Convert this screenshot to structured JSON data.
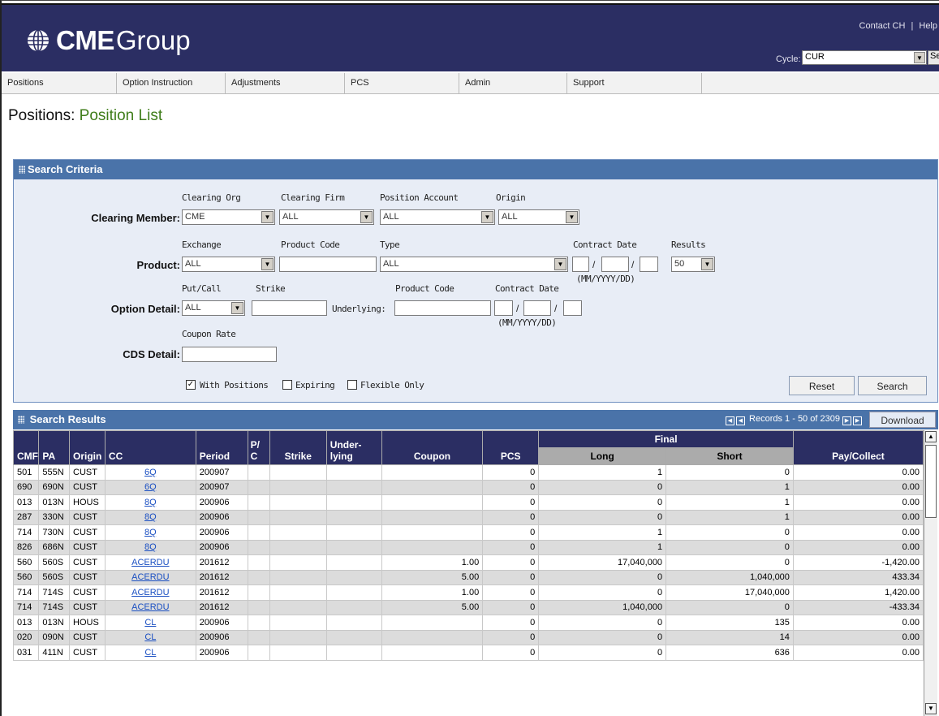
{
  "header": {
    "logo_cme": "CME",
    "logo_group": "Group",
    "links": [
      "Contact CH",
      "Help"
    ],
    "link_sep": "|",
    "cycle_label": "Cycle:",
    "cycle_value": "CUR",
    "go_label": "Se"
  },
  "nav": {
    "items": [
      "Positions",
      "Option Instruction",
      "Adjustments",
      "PCS",
      "Admin",
      "Support",
      ""
    ]
  },
  "page": {
    "title_main": "Positions:",
    "title_sub": "Position List"
  },
  "criteria": {
    "title": "Search Criteria",
    "clearing_member": {
      "label": "Clearing Member:",
      "col_labels": [
        "Clearing Org",
        "Clearing Firm",
        "Position Account",
        "Origin"
      ],
      "values": [
        "CME",
        "ALL",
        "ALL",
        "ALL"
      ]
    },
    "product": {
      "label": "Product:",
      "col_labels": [
        "Exchange",
        "Product Code",
        "Type",
        "Contract Date",
        "Results"
      ],
      "exchange": "ALL",
      "product_code": "",
      "type": "ALL",
      "date_format": "(MM/YYYY/DD)",
      "results": "50"
    },
    "option_detail": {
      "label": "Option Detail:",
      "col_labels": [
        "Put/Call",
        "Strike",
        "Product Code",
        "Contract Date"
      ],
      "put_call": "ALL",
      "strike": "",
      "underlying_label": "Underlying:",
      "underlying": "",
      "date_format": "(MM/YYYY/DD)"
    },
    "cds_detail": {
      "label": "CDS Detail:",
      "col_label": "Coupon Rate",
      "coupon": ""
    },
    "checkboxes": [
      {
        "label": "With Positions",
        "checked": true
      },
      {
        "label": "Expiring",
        "checked": false
      },
      {
        "label": "Flexible Only",
        "checked": false
      }
    ],
    "reset_label": "Reset",
    "search_label": "Search"
  },
  "results": {
    "title": "Search Results",
    "records_text": "Records 1 - 50 of 2309",
    "download_label": "Download",
    "header": {
      "cmf": "CMF",
      "pa": "PA",
      "origin": "Origin",
      "cc": "CC",
      "period": "Period",
      "pc_top": "P/",
      "pc_bottom": "C",
      "strike": "Strike",
      "under_top": "Under-",
      "under_bottom": "lying",
      "coupon": "Coupon",
      "pcs": "PCS",
      "final": "Final",
      "long": "Long",
      "short": "Short",
      "pay": "Pay/Collect"
    },
    "rows": [
      {
        "cmf": "501",
        "pa": "555N",
        "origin": "CUST",
        "cc": "6Q",
        "period": "200907",
        "pc": "",
        "strike": "",
        "under": "",
        "coupon": "",
        "pcs": "0",
        "long": "1",
        "short": "0",
        "pay": "0.00"
      },
      {
        "cmf": "690",
        "pa": "690N",
        "origin": "CUST",
        "cc": "6Q",
        "period": "200907",
        "pc": "",
        "strike": "",
        "under": "",
        "coupon": "",
        "pcs": "0",
        "long": "0",
        "short": "1",
        "pay": "0.00"
      },
      {
        "cmf": "013",
        "pa": "013N",
        "origin": "HOUS",
        "cc": "8Q",
        "period": "200906",
        "pc": "",
        "strike": "",
        "under": "",
        "coupon": "",
        "pcs": "0",
        "long": "0",
        "short": "1",
        "pay": "0.00"
      },
      {
        "cmf": "287",
        "pa": "330N",
        "origin": "CUST",
        "cc": "8Q",
        "period": "200906",
        "pc": "",
        "strike": "",
        "under": "",
        "coupon": "",
        "pcs": "0",
        "long": "0",
        "short": "1",
        "pay": "0.00"
      },
      {
        "cmf": "714",
        "pa": "730N",
        "origin": "CUST",
        "cc": "8Q",
        "period": "200906",
        "pc": "",
        "strike": "",
        "under": "",
        "coupon": "",
        "pcs": "0",
        "long": "1",
        "short": "0",
        "pay": "0.00"
      },
      {
        "cmf": "826",
        "pa": "686N",
        "origin": "CUST",
        "cc": "8Q",
        "period": "200906",
        "pc": "",
        "strike": "",
        "under": "",
        "coupon": "",
        "pcs": "0",
        "long": "1",
        "short": "0",
        "pay": "0.00"
      },
      {
        "cmf": "560",
        "pa": "560S",
        "origin": "CUST",
        "cc": "ACERDU",
        "period": "201612",
        "pc": "",
        "strike": "",
        "under": "",
        "coupon": "1.00",
        "pcs": "0",
        "long": "17,040,000",
        "short": "0",
        "pay": "-1,420.00"
      },
      {
        "cmf": "560",
        "pa": "560S",
        "origin": "CUST",
        "cc": "ACERDU",
        "period": "201612",
        "pc": "",
        "strike": "",
        "under": "",
        "coupon": "5.00",
        "pcs": "0",
        "long": "0",
        "short": "1,040,000",
        "pay": "433.34"
      },
      {
        "cmf": "714",
        "pa": "714S",
        "origin": "CUST",
        "cc": "ACERDU",
        "period": "201612",
        "pc": "",
        "strike": "",
        "under": "",
        "coupon": "1.00",
        "pcs": "0",
        "long": "0",
        "short": "17,040,000",
        "pay": "1,420.00"
      },
      {
        "cmf": "714",
        "pa": "714S",
        "origin": "CUST",
        "cc": "ACERDU",
        "period": "201612",
        "pc": "",
        "strike": "",
        "under": "",
        "coupon": "5.00",
        "pcs": "0",
        "long": "1,040,000",
        "short": "0",
        "pay": "-433.34"
      },
      {
        "cmf": "013",
        "pa": "013N",
        "origin": "HOUS",
        "cc": "CL",
        "period": "200906",
        "pc": "",
        "strike": "",
        "under": "",
        "coupon": "",
        "pcs": "0",
        "long": "0",
        "short": "135",
        "pay": "0.00"
      },
      {
        "cmf": "020",
        "pa": "090N",
        "origin": "CUST",
        "cc": "CL",
        "period": "200906",
        "pc": "",
        "strike": "",
        "under": "",
        "coupon": "",
        "pcs": "0",
        "long": "0",
        "short": "14",
        "pay": "0.00"
      },
      {
        "cmf": "031",
        "pa": "411N",
        "origin": "CUST",
        "cc": "CL",
        "period": "200906",
        "pc": "",
        "strike": "",
        "under": "",
        "coupon": "",
        "pcs": "0",
        "long": "0",
        "short": "636",
        "pay": "0.00"
      }
    ]
  },
  "colors": {
    "header_bg": "#2b2e63",
    "panel_head": "#4a73a9",
    "panel_bg": "#e8edf6",
    "title_green": "#3f7d1a",
    "link": "#1a4fc2"
  }
}
